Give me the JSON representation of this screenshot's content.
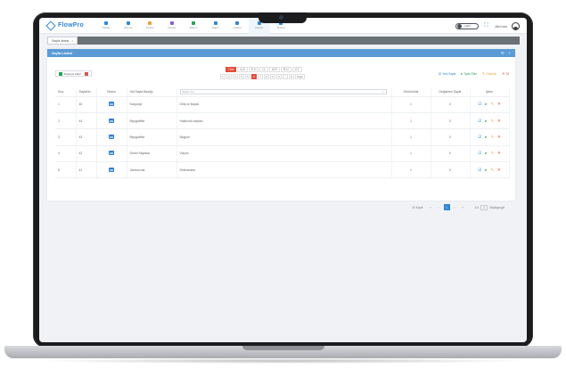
{
  "app": {
    "logo": "FlowPro"
  },
  "nav": [
    {
      "label": "Kartlar",
      "color": "#2f86d6"
    },
    {
      "label": "Hizmet",
      "color": "#2f86d6"
    },
    {
      "label": "Finans",
      "color": "#e8a33b"
    },
    {
      "label": "Ürünler",
      "color": "#8e5bd6"
    },
    {
      "label": "Bakım",
      "color": "#2e9e57"
    },
    {
      "label": "Rapor",
      "color": "#2f86d6"
    },
    {
      "label": "Ayarlar",
      "color": "#2f86d6"
    },
    {
      "label": "Kişisel",
      "color": "#2f86d6"
    },
    {
      "label": "Sistem",
      "color": "#2f86d6"
    }
  ],
  "topbar": {
    "toggle_label": "Light",
    "user_name": "Abd lan"
  },
  "tabs": [
    {
      "label": "Sayfa listesi"
    }
  ],
  "card": {
    "title": "Sayfa Listesi",
    "tools": [
      "⟲",
      "+"
    ]
  },
  "toolbar": {
    "excel_label": "Dışarıya Aktar",
    "letters": [
      "Tüm",
      "A-D",
      "E-H",
      "I-L",
      "M-P",
      "R-U",
      "V-Z"
    ],
    "active_letter": 0,
    "digits": [
      "1",
      "2",
      "3",
      "4",
      "5",
      "6",
      "7",
      "8",
      "9",
      "0",
      "İ",
      "Ş",
      "Diğer"
    ],
    "active_digit": 5,
    "actions": [
      {
        "label": "Yeni Sayfa",
        "color": "#2f86d6",
        "icon": "☑"
      },
      {
        "label": "Toplu Ekle",
        "color": "#2e9e57",
        "icon": "▸"
      },
      {
        "label": "Düzenle",
        "color": "#e8a33b",
        "icon": "✎"
      },
      {
        "label": "Sil",
        "color": "#e54b3c",
        "icon": "✕"
      }
    ]
  },
  "table": {
    "headers": {
      "sira": "Sıra",
      "sayfano": "SayfaNo",
      "resim": "Resim",
      "ust": "Üst Sayfa Başlığı",
      "baslik_placeholder": "Başlık Ara",
      "gorunurluk": "Görünürlük",
      "degistiren": "Değiştiren Sayfa",
      "islem": "İşlem"
    },
    "rows": [
      {
        "sira": "1",
        "sayfano": "45",
        "ust": "Sosyoloji",
        "baslik": "Giriş ve Başlık",
        "gorunurluk": "1",
        "degistiren": "0"
      },
      {
        "sira": "2",
        "sayfano": "44",
        "ust": "Biyografiler",
        "baslik": "Hakkında sayfası",
        "gorunurluk": "1",
        "degistiren": "0"
      },
      {
        "sira": "3",
        "sayfano": "43",
        "ust": "Biyografiler",
        "baslik": "Blogum",
        "gorunurluk": "1",
        "degistiren": "0"
      },
      {
        "sira": "4",
        "sayfano": "42",
        "ust": "Genel Sayfalar",
        "baslik": "Vizyon",
        "gorunurluk": "1",
        "degistiren": "0"
      },
      {
        "sira": "5",
        "sayfano": "41",
        "ust": "Yardımcılar",
        "baslik": "Referanslar",
        "gorunurluk": "1",
        "degistiren": "0"
      }
    ]
  },
  "pager": {
    "label": "10 Kayıt",
    "pages": [
      "«",
      "‹",
      "1",
      "›",
      "»"
    ],
    "active": 2,
    "per_page_label": "1/1",
    "go_label": "Sayfaya git"
  }
}
